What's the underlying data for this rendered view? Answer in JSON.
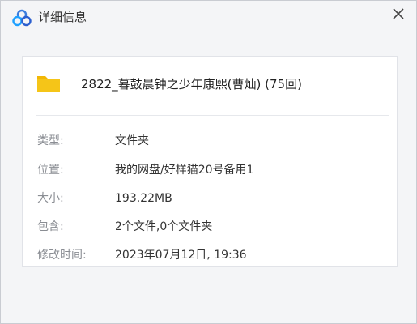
{
  "window": {
    "title": "详细信息",
    "icons": {
      "app": "cloud-logo-icon",
      "close": "close-icon"
    }
  },
  "file": {
    "icon": "folder-icon",
    "name": "2822_暮鼓晨钟之少年康熙(曹灿) (75回)"
  },
  "details": [
    {
      "label": "类型:",
      "value": "文件夹"
    },
    {
      "label": "位置:",
      "value": "我的网盘/好样猫20号备用1"
    },
    {
      "label": "大小:",
      "value": "193.22MB"
    },
    {
      "label": "包含:",
      "value": "2个文件,0个文件夹"
    },
    {
      "label": "修改时间:",
      "value": "2023年07月12日, 19:36"
    }
  ],
  "colors": {
    "folder": "#f5c518",
    "brand_blue": "#3b7dde",
    "label": "#8a8d93"
  }
}
